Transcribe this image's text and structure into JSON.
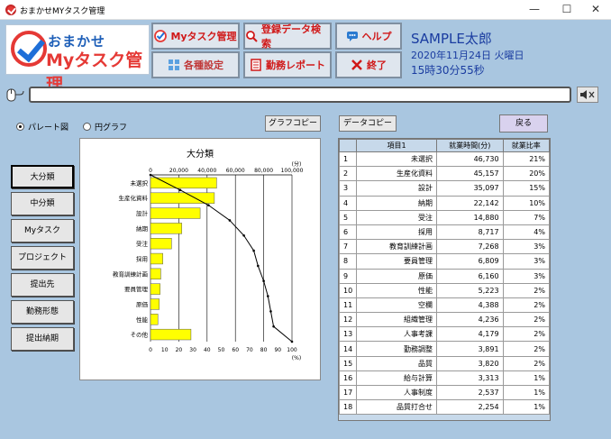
{
  "window": {
    "title": "おまかせMYタスク管理",
    "minimize": "—",
    "maximize": "☐",
    "close": "✕"
  },
  "logo": {
    "line1": "おまかせ",
    "line2": "Myタスク管理"
  },
  "toolbar": {
    "my_task": "Myタスク管理",
    "register_search": "登録データ検索",
    "help": "ヘルプ",
    "settings": "各種設定",
    "work_report": "勤務レポート",
    "exit": "終了"
  },
  "user": {
    "name": "SAMPLE太郎",
    "date": "2020年11月24日  火曜日",
    "time": "15時30分55秒"
  },
  "input": {
    "value": ""
  },
  "view_options": {
    "pareto": "パレート図",
    "pie": "円グラフ",
    "selected": "pareto"
  },
  "actions": {
    "graph_copy": "グラフコピー",
    "data_copy": "データコピー",
    "back": "戻る"
  },
  "categories": [
    "大分類",
    "中分類",
    "Myタスク",
    "プロジェクト",
    "提出先",
    "勤務形態",
    "提出納期"
  ],
  "active_category": "大分類",
  "table": {
    "headers": [
      "",
      "項目1",
      "就業時間(分)",
      "就業比率"
    ],
    "rows": [
      [
        "1",
        "未選択",
        "46,730",
        "21%"
      ],
      [
        "2",
        "生産化資料",
        "45,157",
        "20%"
      ],
      [
        "3",
        "設計",
        "35,097",
        "15%"
      ],
      [
        "4",
        "納期",
        "22,142",
        "10%"
      ],
      [
        "5",
        "受注",
        "14,880",
        "7%"
      ],
      [
        "6",
        "採用",
        "8,717",
        "4%"
      ],
      [
        "7",
        "教育訓練計画",
        "7,268",
        "3%"
      ],
      [
        "8",
        "要員管理",
        "6,809",
        "3%"
      ],
      [
        "9",
        "原価",
        "6,160",
        "3%"
      ],
      [
        "10",
        "性能",
        "5,223",
        "2%"
      ],
      [
        "11",
        "空欄",
        "4,388",
        "2%"
      ],
      [
        "12",
        "組織管理",
        "4,236",
        "2%"
      ],
      [
        "13",
        "人事考課",
        "4,179",
        "2%"
      ],
      [
        "14",
        "勤務調整",
        "3,891",
        "2%"
      ],
      [
        "15",
        "品質",
        "3,820",
        "2%"
      ],
      [
        "16",
        "給与計算",
        "3,313",
        "1%"
      ],
      [
        "17",
        "人事制度",
        "2,537",
        "1%"
      ],
      [
        "18",
        "品質打合せ",
        "2,254",
        "1%"
      ]
    ]
  },
  "chart_data": {
    "type": "bar",
    "title": "大分類",
    "top_axis_unit": "(分)",
    "bottom_axis_unit": "(%)",
    "top_ticks": [
      "0",
      "20,000",
      "40,000",
      "60,000",
      "80,000",
      "100,000"
    ],
    "bottom_ticks": [
      "0",
      "10",
      "20",
      "30",
      "40",
      "50",
      "60",
      "70",
      "80",
      "90",
      "100"
    ],
    "xlim_minutes": [
      0,
      100000
    ],
    "categories": [
      "未選択",
      "生産化資料",
      "設計",
      "納期",
      "受注",
      "採用",
      "教育訓練計画",
      "要員管理",
      "原価",
      "性能",
      "その他"
    ],
    "values": [
      46730,
      45157,
      35097,
      22142,
      14880,
      8717,
      7268,
      6809,
      6160,
      5223,
      28618
    ],
    "cumulative_percent": [
      0,
      21,
      41,
      56,
      66,
      73,
      76,
      80,
      83,
      85,
      87,
      100
    ],
    "bar_color": "#ffff00",
    "line_color": "#000000"
  }
}
